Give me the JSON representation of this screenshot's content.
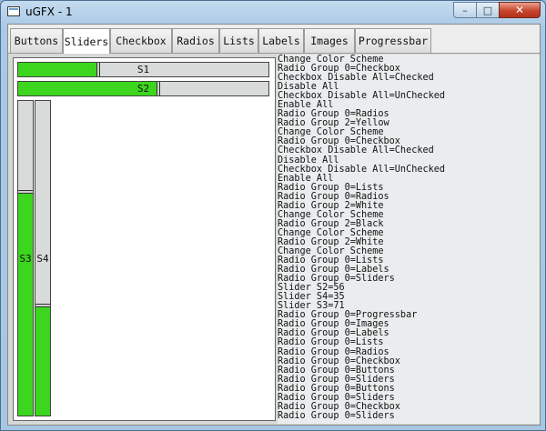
{
  "window": {
    "title": "uGFX - 1",
    "controls": {
      "minimize": "–",
      "maximize": "□",
      "close": "✕"
    }
  },
  "tabs": [
    {
      "label": "Buttons",
      "active": false
    },
    {
      "label": "Sliders",
      "active": true
    },
    {
      "label": "Checkbox",
      "active": false
    },
    {
      "label": "Radios",
      "active": false
    },
    {
      "label": "Lists",
      "active": false
    },
    {
      "label": "Labels",
      "active": false
    },
    {
      "label": "Images",
      "active": false
    },
    {
      "label": "Progressbar",
      "active": false
    }
  ],
  "sliders": {
    "s1": {
      "label": "S1",
      "value_percent": 32
    },
    "s2": {
      "label": "S2",
      "value_percent": 56
    },
    "s3": {
      "label": "S3",
      "value_percent": 71
    },
    "s4": {
      "label": "S4",
      "value_percent": 35
    }
  },
  "colors": {
    "fill": "#3cd61e",
    "track": "#d9dada",
    "accent_close": "#c8452c"
  },
  "console_lines": [
    "Change Color Scheme",
    "Radio Group 0=Checkbox",
    "Checkbox Disable All=Checked",
    "Disable All",
    "Checkbox Disable All=UnChecked",
    "Enable All",
    "Radio Group 0=Radios",
    "Radio Group 2=Yellow",
    "Change Color Scheme",
    "Radio Group 0=Checkbox",
    "Checkbox Disable All=Checked",
    "Disable All",
    "Checkbox Disable All=UnChecked",
    "Enable All",
    "Radio Group 0=Lists",
    "Radio Group 0=Radios",
    "Radio Group 2=White",
    "Change Color Scheme",
    "Radio Group 2=Black",
    "Change Color Scheme",
    "Radio Group 2=White",
    "Change Color Scheme",
    "Radio Group 0=Lists",
    "Radio Group 0=Labels",
    "Radio Group 0=Sliders",
    "Slider S2=56",
    "Slider S4=35",
    "Slider S3=71",
    "Radio Group 0=Progressbar",
    "Radio Group 0=Images",
    "Radio Group 0=Labels",
    "Radio Group 0=Lists",
    "Radio Group 0=Radios",
    "Radio Group 0=Checkbox",
    "Radio Group 0=Buttons",
    "Radio Group 0=Sliders",
    "Radio Group 0=Buttons",
    "Radio Group 0=Sliders",
    "Radio Group 0=Checkbox",
    "Radio Group 0=Sliders"
  ]
}
